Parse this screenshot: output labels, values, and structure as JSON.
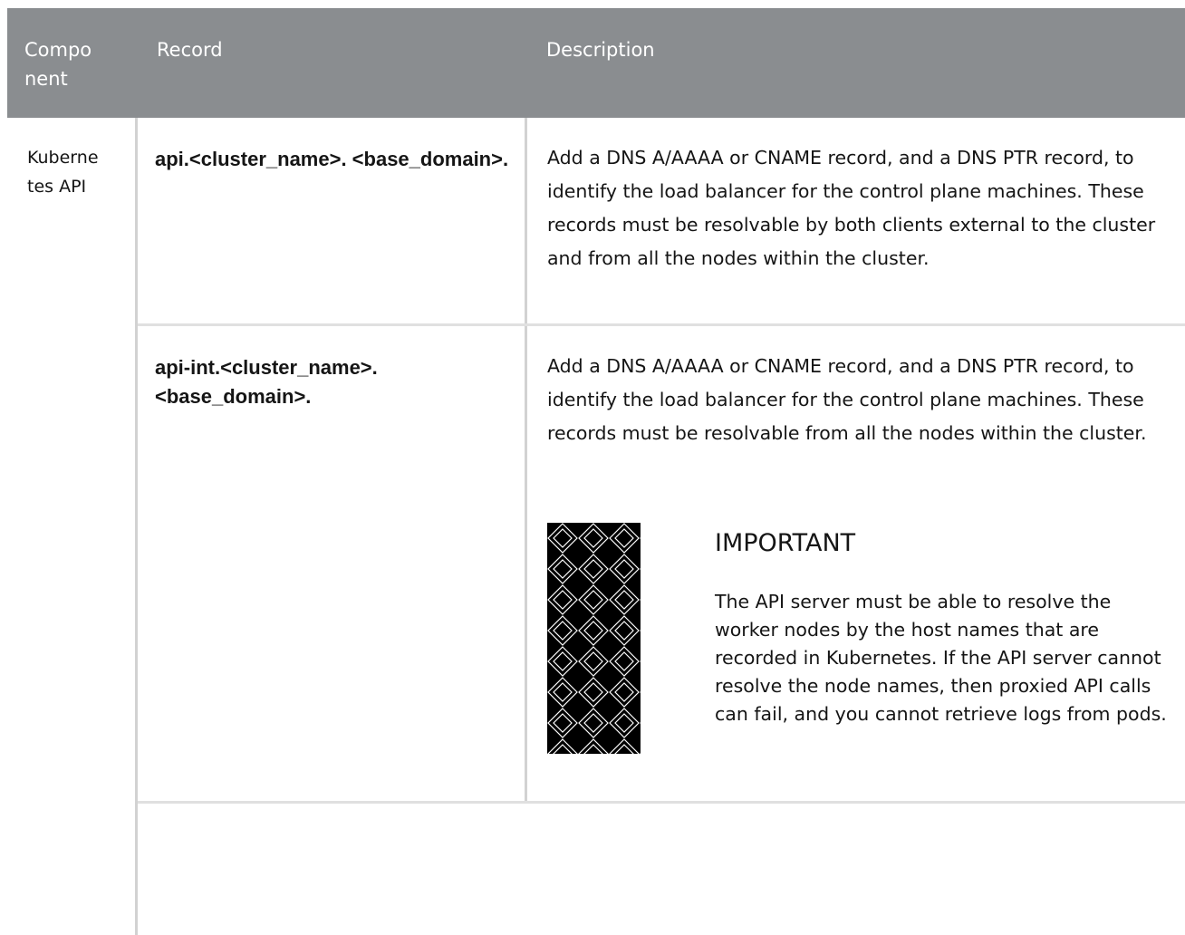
{
  "table": {
    "headers": {
      "component": "Compo nent",
      "record": "Record",
      "description": "Description"
    },
    "component_label": "Kuberne tes API",
    "rows": [
      {
        "record": "api.<cluster_name>. <base_domain>.",
        "description": "Add a DNS A/AAAA or CNAME record, and a DNS PTR record, to identify the load balancer for the control plane machines. These records must be resolvable by both clients external to the cluster and from all the nodes within the cluster."
      },
      {
        "record": "api-int.<cluster_name>. <base_domain>.",
        "description": "Add a DNS A/AAAA or CNAME record, and a DNS PTR record, to identify the load balancer for the control plane machines. These records must be resolvable from all the nodes within the cluster.",
        "admonition": {
          "icon": "important-pattern-icon",
          "title": "IMPORTANT",
          "text": "The API server must be able to resolve the worker nodes by the host names that are recorded in Kubernetes. If the API server cannot resolve the node names, then proxied API calls can fail, and you cannot retrieve logs from pods."
        }
      }
    ]
  },
  "colors": {
    "header_background": "#8a8d90",
    "header_text": "#ffffff",
    "body_text": "#151515",
    "border": "#d2d2d2"
  }
}
